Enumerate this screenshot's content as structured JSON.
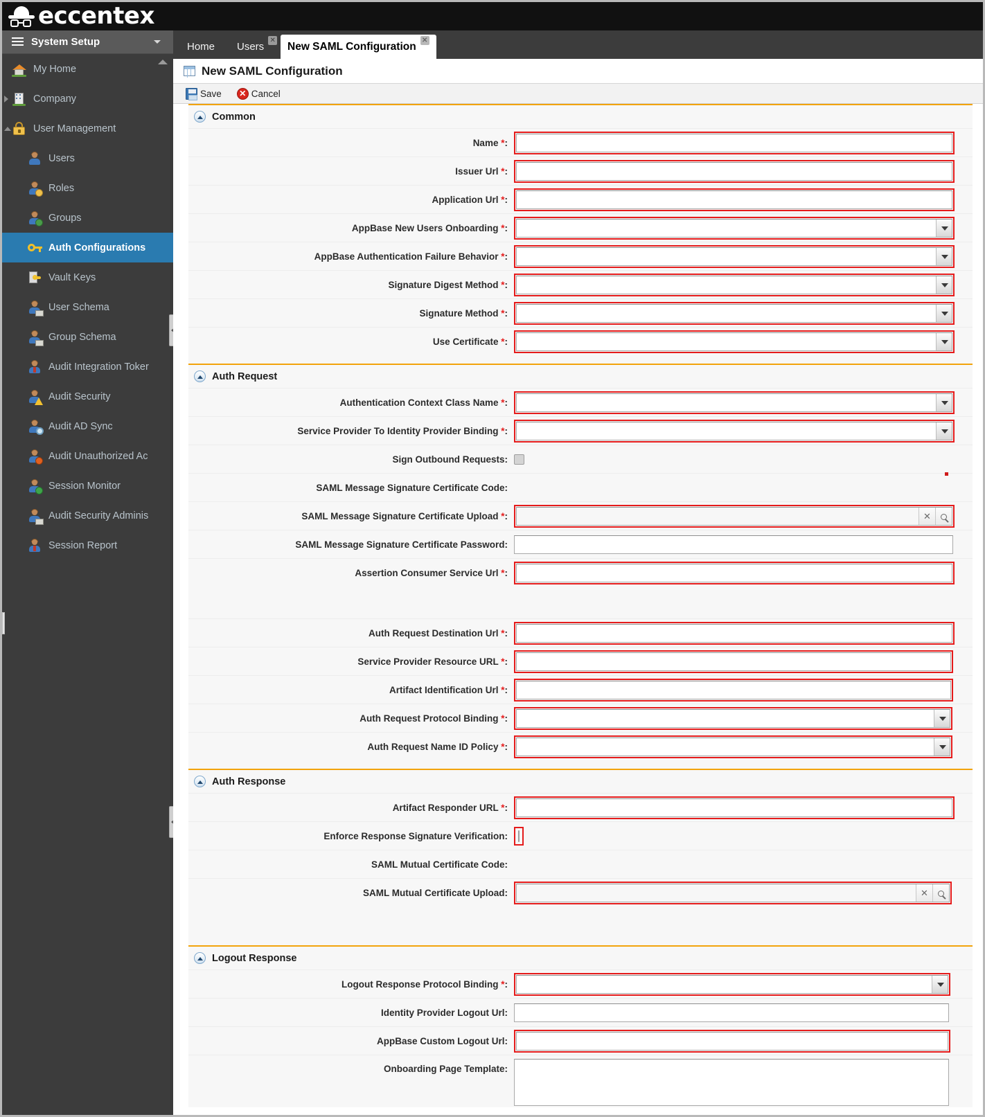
{
  "brand": {
    "name": "eccentex",
    "logo_icon": "bowler-hat-glasses-icon"
  },
  "sidebar": {
    "header": {
      "title": "System Setup",
      "menu_icon": "hamburger-icon",
      "caret_icon": "caret-down-icon"
    },
    "items": [
      {
        "label": "My Home",
        "icon": "home-icon",
        "level": 0,
        "state": ""
      },
      {
        "label": "Company",
        "icon": "building-icon",
        "level": 0,
        "state": "collapsed"
      },
      {
        "label": "User Management",
        "icon": "lock-icon",
        "level": 0,
        "state": "expanded"
      },
      {
        "label": "Users",
        "icon": "user-icon",
        "level": 1,
        "state": ""
      },
      {
        "label": "Roles",
        "icon": "user-roles-icon",
        "level": 1,
        "state": ""
      },
      {
        "label": "Groups",
        "icon": "user-group-icon",
        "level": 1,
        "state": ""
      },
      {
        "label": "Auth Configurations",
        "icon": "key-icon",
        "level": 1,
        "state": "active"
      },
      {
        "label": "Vault Keys",
        "icon": "vault-key-icon",
        "level": 1,
        "state": ""
      },
      {
        "label": "User Schema",
        "icon": "user-schema-icon",
        "level": 1,
        "state": ""
      },
      {
        "label": "Group Schema",
        "icon": "group-schema-icon",
        "level": 1,
        "state": ""
      },
      {
        "label": "Audit Integration Toker",
        "icon": "user-tie-icon",
        "level": 1,
        "state": ""
      },
      {
        "label": "Audit Security",
        "icon": "user-warning-icon",
        "level": 1,
        "state": ""
      },
      {
        "label": "Audit AD Sync",
        "icon": "user-magnifier-icon",
        "level": 1,
        "state": ""
      },
      {
        "label": "Audit Unauthorized Ac",
        "icon": "user-blocked-icon",
        "level": 1,
        "state": ""
      },
      {
        "label": "Session Monitor",
        "icon": "user-globe-icon",
        "level": 1,
        "state": ""
      },
      {
        "label": "Audit Security Adminis",
        "icon": "user-house-icon",
        "level": 1,
        "state": ""
      },
      {
        "label": "Session Report",
        "icon": "user-report-icon",
        "level": 1,
        "state": ""
      }
    ]
  },
  "tabs": [
    {
      "label": "Home",
      "closable": false,
      "active": false
    },
    {
      "label": "Users",
      "closable": true,
      "active": false
    },
    {
      "label": "New SAML Configuration",
      "closable": true,
      "active": true
    }
  ],
  "page": {
    "title": "New SAML Configuration",
    "icon": "grid-form-icon"
  },
  "toolbar": {
    "save_label": "Save",
    "save_icon": "save-disk-icon",
    "cancel_label": "Cancel",
    "cancel_icon": "cancel-x-icon",
    "cancel_glyph": "✕"
  },
  "sections": [
    {
      "title": "Common",
      "collapse_icon": "collapse-up-icon",
      "fields": [
        {
          "label": "Name",
          "required": true,
          "type": "text",
          "value": "",
          "error": true
        },
        {
          "label": "Issuer Url",
          "required": true,
          "type": "text",
          "value": "",
          "error": true
        },
        {
          "label": "Application Url",
          "required": true,
          "type": "text",
          "value": "",
          "error": true
        },
        {
          "label": "AppBase New Users Onboarding",
          "required": true,
          "type": "select",
          "value": "",
          "error": true
        },
        {
          "label": "AppBase Authentication Failure Behavior",
          "required": true,
          "type": "select",
          "value": "",
          "error": true
        },
        {
          "label": "Signature Digest Method",
          "required": true,
          "type": "select",
          "value": "",
          "error": true
        },
        {
          "label": "Signature Method",
          "required": true,
          "type": "select",
          "value": "",
          "error": true
        },
        {
          "label": "Use Certificate",
          "required": true,
          "type": "select",
          "value": "",
          "error": true
        }
      ]
    },
    {
      "title": "Auth Request",
      "collapse_icon": "collapse-up-icon",
      "fields": [
        {
          "label": "Authentication Context Class Name",
          "required": true,
          "type": "select",
          "value": "",
          "error": true
        },
        {
          "label": "Service Provider To Identity Provider Binding",
          "required": true,
          "type": "select",
          "value": "",
          "error": true
        },
        {
          "label": "Sign Outbound Requests",
          "required": false,
          "type": "checkbox",
          "checked": false,
          "error": false
        },
        {
          "label": "SAML Message Signature Certificate Code",
          "required": false,
          "type": "static",
          "value": ""
        },
        {
          "label": "SAML Message Signature Certificate Upload",
          "required": true,
          "type": "file",
          "value": "",
          "error": true,
          "clear_icon": "clear-x-icon",
          "browse_icon": "magnifier-icon",
          "clear_glyph": "✕"
        },
        {
          "label": "SAML Message Signature Certificate Password",
          "required": false,
          "type": "text",
          "value": "",
          "error": false
        },
        {
          "label": "Assertion Consumer Service Url",
          "required": true,
          "type": "text",
          "value": "",
          "error": true
        },
        {
          "label": "Auth Request Destination Url",
          "required": true,
          "type": "text",
          "value": "",
          "error": true
        },
        {
          "label": "Service Provider Resource URL",
          "required": true,
          "type": "text",
          "value": "",
          "error": true
        },
        {
          "label": "Artifact Identification Url",
          "required": true,
          "type": "text",
          "value": "",
          "error": true
        },
        {
          "label": "Auth Request Protocol Binding",
          "required": true,
          "type": "select",
          "value": "",
          "error": true
        },
        {
          "label": "Auth Request Name ID Policy",
          "required": true,
          "type": "select",
          "value": "",
          "error": true
        }
      ]
    },
    {
      "title": "Auth Response",
      "collapse_icon": "collapse-up-icon",
      "fields": [
        {
          "label": "Artifact Responder URL",
          "required": true,
          "type": "text",
          "value": "",
          "error": true
        },
        {
          "label": "Enforce Response Signature Verification",
          "required": false,
          "type": "checkbox",
          "checked": false,
          "error": true
        },
        {
          "label": "SAML Mutual Certificate Code",
          "required": false,
          "type": "static",
          "value": ""
        },
        {
          "label": "SAML Mutual Certificate Upload",
          "required": false,
          "type": "file",
          "value": "",
          "error": true,
          "clear_icon": "clear-x-icon",
          "browse_icon": "magnifier-icon",
          "clear_glyph": "✕"
        }
      ]
    },
    {
      "title": "Logout Response",
      "collapse_icon": "collapse-up-icon",
      "fields": [
        {
          "label": "Logout Response Protocol Binding",
          "required": true,
          "type": "select",
          "value": "",
          "error": true
        },
        {
          "label": "Identity Provider Logout Url",
          "required": false,
          "type": "text",
          "value": "",
          "error": false
        },
        {
          "label": "AppBase Custom Logout Url",
          "required": false,
          "type": "text",
          "value": "",
          "error": true
        },
        {
          "label": "Onboarding Page Template",
          "required": false,
          "type": "textarea",
          "value": "",
          "error": false
        }
      ]
    }
  ],
  "colors": {
    "brand_bar": "#111111",
    "sidebar_bg": "#3c3c3c",
    "sidebar_header_bg": "#5a5a5a",
    "active_item": "#2a7bb0",
    "section_rule": "#f2a30b",
    "error_border": "#e51b1b",
    "form_bg": "#f7f7f7"
  }
}
